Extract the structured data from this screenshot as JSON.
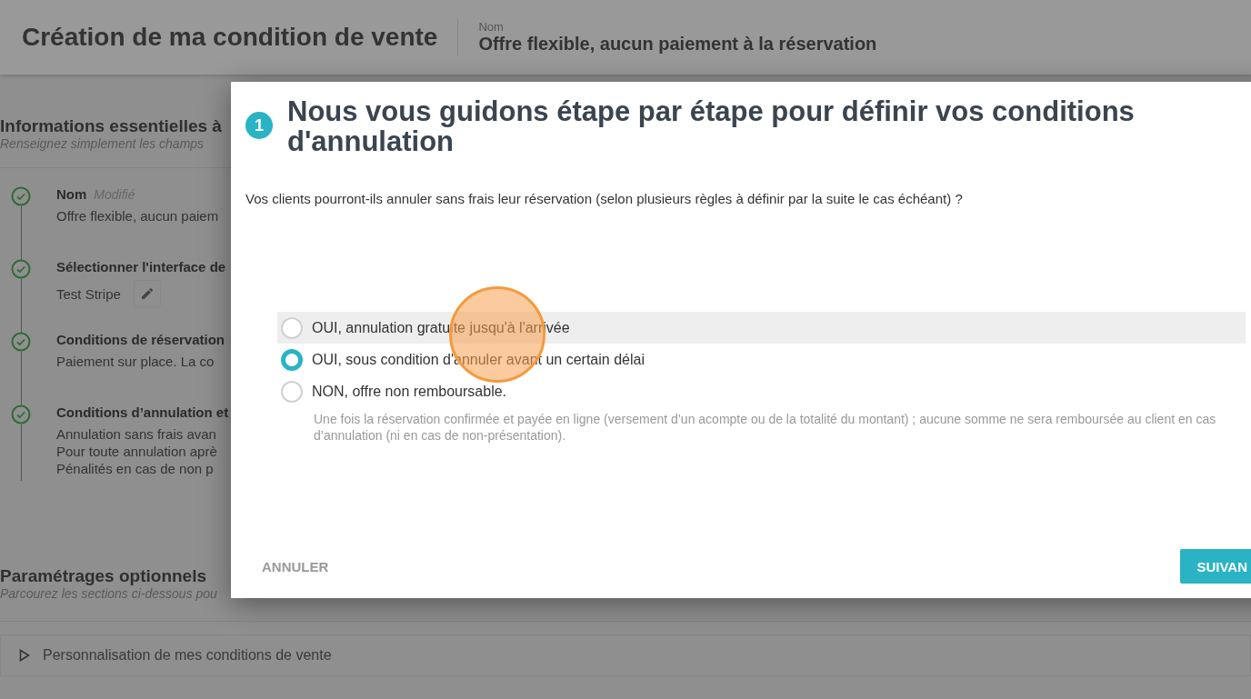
{
  "header": {
    "title": "Création de ma condition de vente",
    "name_label": "Nom",
    "name_value": "Offre flexible, aucun paiement à la réservation"
  },
  "essentials": {
    "title": "Informations essentielles à",
    "subtitle": "Renseignez simplement les champs",
    "steps": [
      {
        "title": "Nom",
        "tag": "Modifié",
        "lines": [
          "Offre flexible, aucun paiem"
        ],
        "done": true,
        "editable": false
      },
      {
        "title": "Sélectionner l'interface de",
        "lines": [
          "Test Stripe"
        ],
        "done": true,
        "editable": true
      },
      {
        "title": "Conditions de réservation",
        "lines": [
          "Paiement sur place. La co"
        ],
        "done": true,
        "editable": false
      },
      {
        "title": "Conditions d’annulation et",
        "lines": [
          "Annulation sans frais avan",
          "Pour toute annulation aprè",
          "Pénalités en cas de non p"
        ],
        "done": true,
        "editable": false
      }
    ]
  },
  "optional": {
    "title": "Paramétrages optionnels",
    "subtitle": "Parcourez les sections ci-dessous pou",
    "sections": [
      {
        "label": "Personnalisation de mes conditions de vente",
        "expanded": false
      }
    ]
  },
  "dialog": {
    "step": "1",
    "title": "Nous vous guidons étape par étape pour définir vos conditions d'annulation",
    "question": "Vos clients pourront-ils annuler sans frais leur réservation (selon plusieurs règles à définir par la suite le cas échéant) ?",
    "options": [
      {
        "label": "OUI, annulation gratuite jusqu'à l'arrivée",
        "selected": false,
        "highlighted": true
      },
      {
        "label": "OUI, sous condition d'annuler avant un certain délai",
        "selected": true,
        "highlighted": false
      },
      {
        "label": "NON, offre non remboursable.",
        "selected": false,
        "highlighted": false,
        "description": "Une fois la réservation confirmée et payée en ligne (versement d’un acompte ou de la totalité du montant) ; aucune somme ne sera remboursée au client en cas d’annulation (ni en cas de non-présentation)."
      }
    ],
    "cancel": "ANNULER",
    "next": "SUIVAN"
  }
}
